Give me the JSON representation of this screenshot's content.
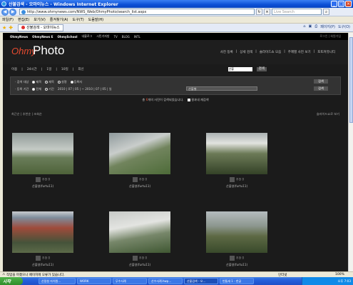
{
  "window": {
    "title": "산불검색 - 오마이뉴스 - Windows Internet Explorer"
  },
  "address": {
    "url": "http://www.ohmynews.com/NWS_Web/OhmyPhoto/search_list.aspx",
    "search_placeholder": "Live Search"
  },
  "menu": [
    "파일(F)",
    "편집(E)",
    "보기(V)",
    "즐겨찾기(A)",
    "도구(T)",
    "도움말(H)"
  ],
  "tab": {
    "label": "산불검색 - 오마이뉴스"
  },
  "commands": [
    "페이지(P)",
    "도구(O)"
  ],
  "gnb": {
    "items": [
      "OhmyNews",
      "OhmyNews E",
      "OhmySchool",
      "내블로그",
      "시민기자방",
      "TV",
      "BLOG",
      "INTL"
    ],
    "right": "로그인 | 회원가입"
  },
  "brand": {
    "logo_ohmy": "Ohmy",
    "logo_photo": "Photo",
    "nav": [
      "사진 등록",
      "상세 검색",
      "슬라이드쇼 모음",
      "주제별 사진 보기",
      "포토커뮤니티"
    ]
  },
  "filter": {
    "labels": [
      "이용",
      "24시간",
      "1일",
      "10일",
      "최신"
    ],
    "select": "산불",
    "go": "검색"
  },
  "adv": {
    "row1_label": "· 검색 대상",
    "row1_opts": [
      "제목",
      "제목",
      "설명",
      "등록자"
    ],
    "row2_label": "· 등록 기간",
    "row2_opts": [
      "전체",
      "기간"
    ],
    "dates": "2010 | 07 | 05 | ~ 2010 | 07 | 05 | 일",
    "input": "산불별",
    "btn1": "검색",
    "btn2": "검색"
  },
  "result": {
    "prefix": "총",
    "count": "6",
    "suffix": "개의 사진이 검색되었습니다.",
    "check_label": "결과내 재검색"
  },
  "sort": {
    "left": "최근순 | 추천순 | 조회순",
    "right": "슬라이드쇼로 보기"
  },
  "photos": [
    {
      "meta": "추천 0",
      "cap": "산불영(furtu11)"
    },
    {
      "meta": "추천 0",
      "cap": "산불영(furtu11)"
    },
    {
      "meta": "추천 0",
      "cap": "산불영(furtu11)"
    },
    {
      "meta": "추천 0",
      "cap": "산불영(furtu11)"
    },
    {
      "meta": "추천 0",
      "cap": "산불영(furtu11)"
    },
    {
      "meta": "추천 0",
      "cap": "산불영(furtu11)"
    }
  ],
  "status": {
    "text": "작업을 마쳤으나 페이지에 오류가 있습니다.",
    "zone": "인터넷",
    "zoom": "100%"
  },
  "taskbar": {
    "start": "시작",
    "items": [
      "산림청 자치원...",
      "WORK",
      "무수사례",
      "산수사례.hwp...",
      "산불검색 - 오...",
      "빈틈새 1 - 한글"
    ],
    "clock": "오후 7:03"
  }
}
